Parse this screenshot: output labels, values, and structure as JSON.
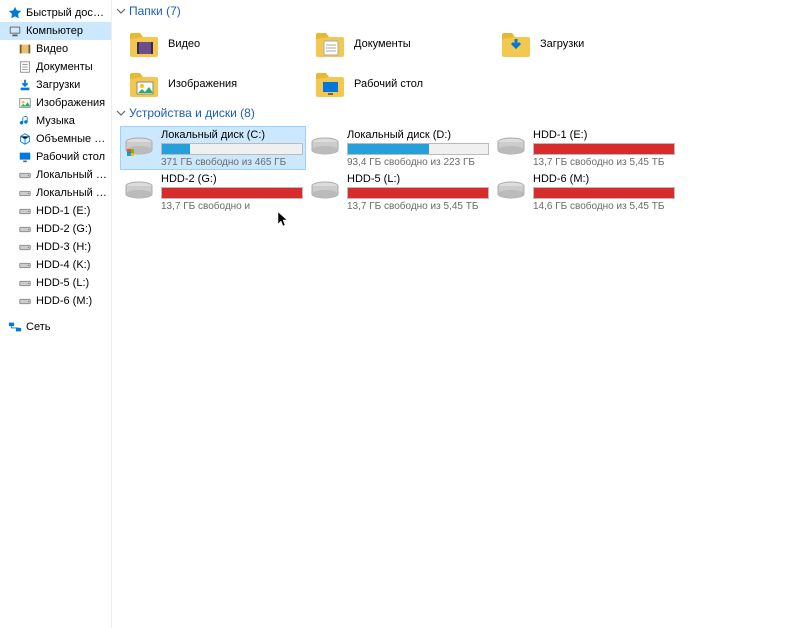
{
  "sidebar": [
    {
      "id": "quick-access",
      "label": "Быстрый доступ",
      "icon": "star",
      "color": "#0078d7"
    },
    {
      "id": "computer",
      "label": "Компьютер",
      "icon": "computer",
      "color": "#5c5c5c",
      "selected": true
    },
    {
      "id": "videos",
      "label": "Видео",
      "icon": "video",
      "color": "#5c5c5c"
    },
    {
      "id": "documents",
      "label": "Документы",
      "icon": "doc",
      "color": "#5c5c5c"
    },
    {
      "id": "downloads",
      "label": "Загрузки",
      "icon": "download",
      "color": "#0078d7"
    },
    {
      "id": "pictures",
      "label": "Изображения",
      "icon": "picture",
      "color": "#5c5c5c"
    },
    {
      "id": "music",
      "label": "Музыка",
      "icon": "music",
      "color": "#0078d7"
    },
    {
      "id": "3dobjects",
      "label": "Объемные объек",
      "icon": "cube",
      "color": "#0078d7"
    },
    {
      "id": "desktop",
      "label": "Рабочий стол",
      "icon": "desktop",
      "color": "#0078d7"
    },
    {
      "id": "localc",
      "label": "Локальный диск (C",
      "icon": "drive",
      "color": "#888"
    },
    {
      "id": "locald",
      "label": "Локальный диск (",
      "icon": "drive",
      "color": "#888"
    },
    {
      "id": "hdd1",
      "label": "HDD-1 (E:)",
      "icon": "drive",
      "color": "#888"
    },
    {
      "id": "hdd2",
      "label": "HDD-2 (G:)",
      "icon": "drive",
      "color": "#888"
    },
    {
      "id": "hdd3",
      "label": "HDD-3 (H:)",
      "icon": "drive",
      "color": "#888"
    },
    {
      "id": "hdd4",
      "label": "HDD-4 (K:)",
      "icon": "drive",
      "color": "#888"
    },
    {
      "id": "hdd5",
      "label": "HDD-5 (L:)",
      "icon": "drive",
      "color": "#888"
    },
    {
      "id": "hdd6",
      "label": "HDD-6 (M:)",
      "icon": "drive",
      "color": "#888"
    },
    {
      "id": "network",
      "label": "Сеть",
      "icon": "network",
      "color": "#0078d7"
    }
  ],
  "groups": {
    "folders": {
      "label": "Папки",
      "count": 7
    },
    "drives": {
      "label": "Устройства и диски",
      "count": 8
    }
  },
  "folders": [
    {
      "id": "videos",
      "label": "Видео",
      "icon": "video"
    },
    {
      "id": "documents",
      "label": "Документы",
      "icon": "doc"
    },
    {
      "id": "downloads",
      "label": "Загрузки",
      "icon": "download"
    },
    {
      "id": "pictures",
      "label": "Изображения",
      "icon": "picture"
    },
    {
      "id": "desktop",
      "label": "Рабочий стол",
      "icon": "desktop"
    }
  ],
  "drives": [
    {
      "id": "c",
      "label": "Локальный диск (C:)",
      "free": "371 ГБ свободно из 465 ГБ",
      "pct": 20,
      "color": "#26a0da",
      "selected": true,
      "os": true
    },
    {
      "id": "d",
      "label": "Локальный диск (D:)",
      "free": "93,4 ГБ свободно из 223 ГБ",
      "pct": 58,
      "color": "#26a0da"
    },
    {
      "id": "e",
      "label": "HDD-1 (E:)",
      "free": "13,7 ГБ свободно из 5,45 ТБ",
      "pct": 100,
      "color": "#d62c2c"
    },
    {
      "id": "g",
      "label": "HDD-2 (G:)",
      "free": "13,7 ГБ свободно и",
      "pct": 100,
      "color": "#d62c2c"
    },
    {
      "id": "l",
      "label": "HDD-5 (L:)",
      "free": "13,7 ГБ свободно из 5,45 ТБ",
      "pct": 100,
      "color": "#d62c2c"
    },
    {
      "id": "m",
      "label": "HDD-6 (M:)",
      "free": "14,6 ГБ свободно из 5,45 ТБ",
      "pct": 100,
      "color": "#d62c2c"
    }
  ]
}
